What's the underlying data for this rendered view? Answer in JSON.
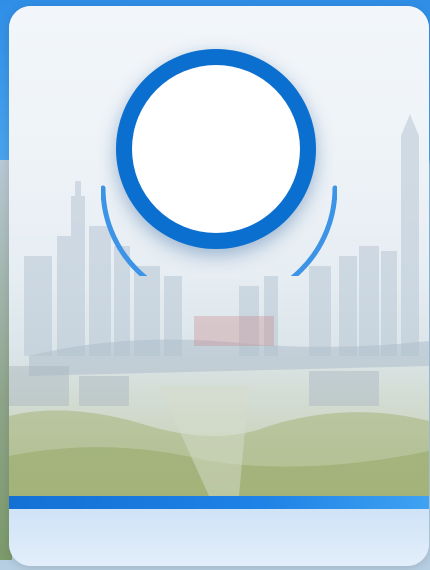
{
  "colors": {
    "accent": "#1a7ae0",
    "ring": "#0b6fd0",
    "card_background": "#edf3f8",
    "bottom_panel": "#dbeaf8"
  },
  "avatar": {
    "icon": "avatar-placeholder-icon"
  },
  "background_image": {
    "icon": "city-skyline-icon"
  }
}
